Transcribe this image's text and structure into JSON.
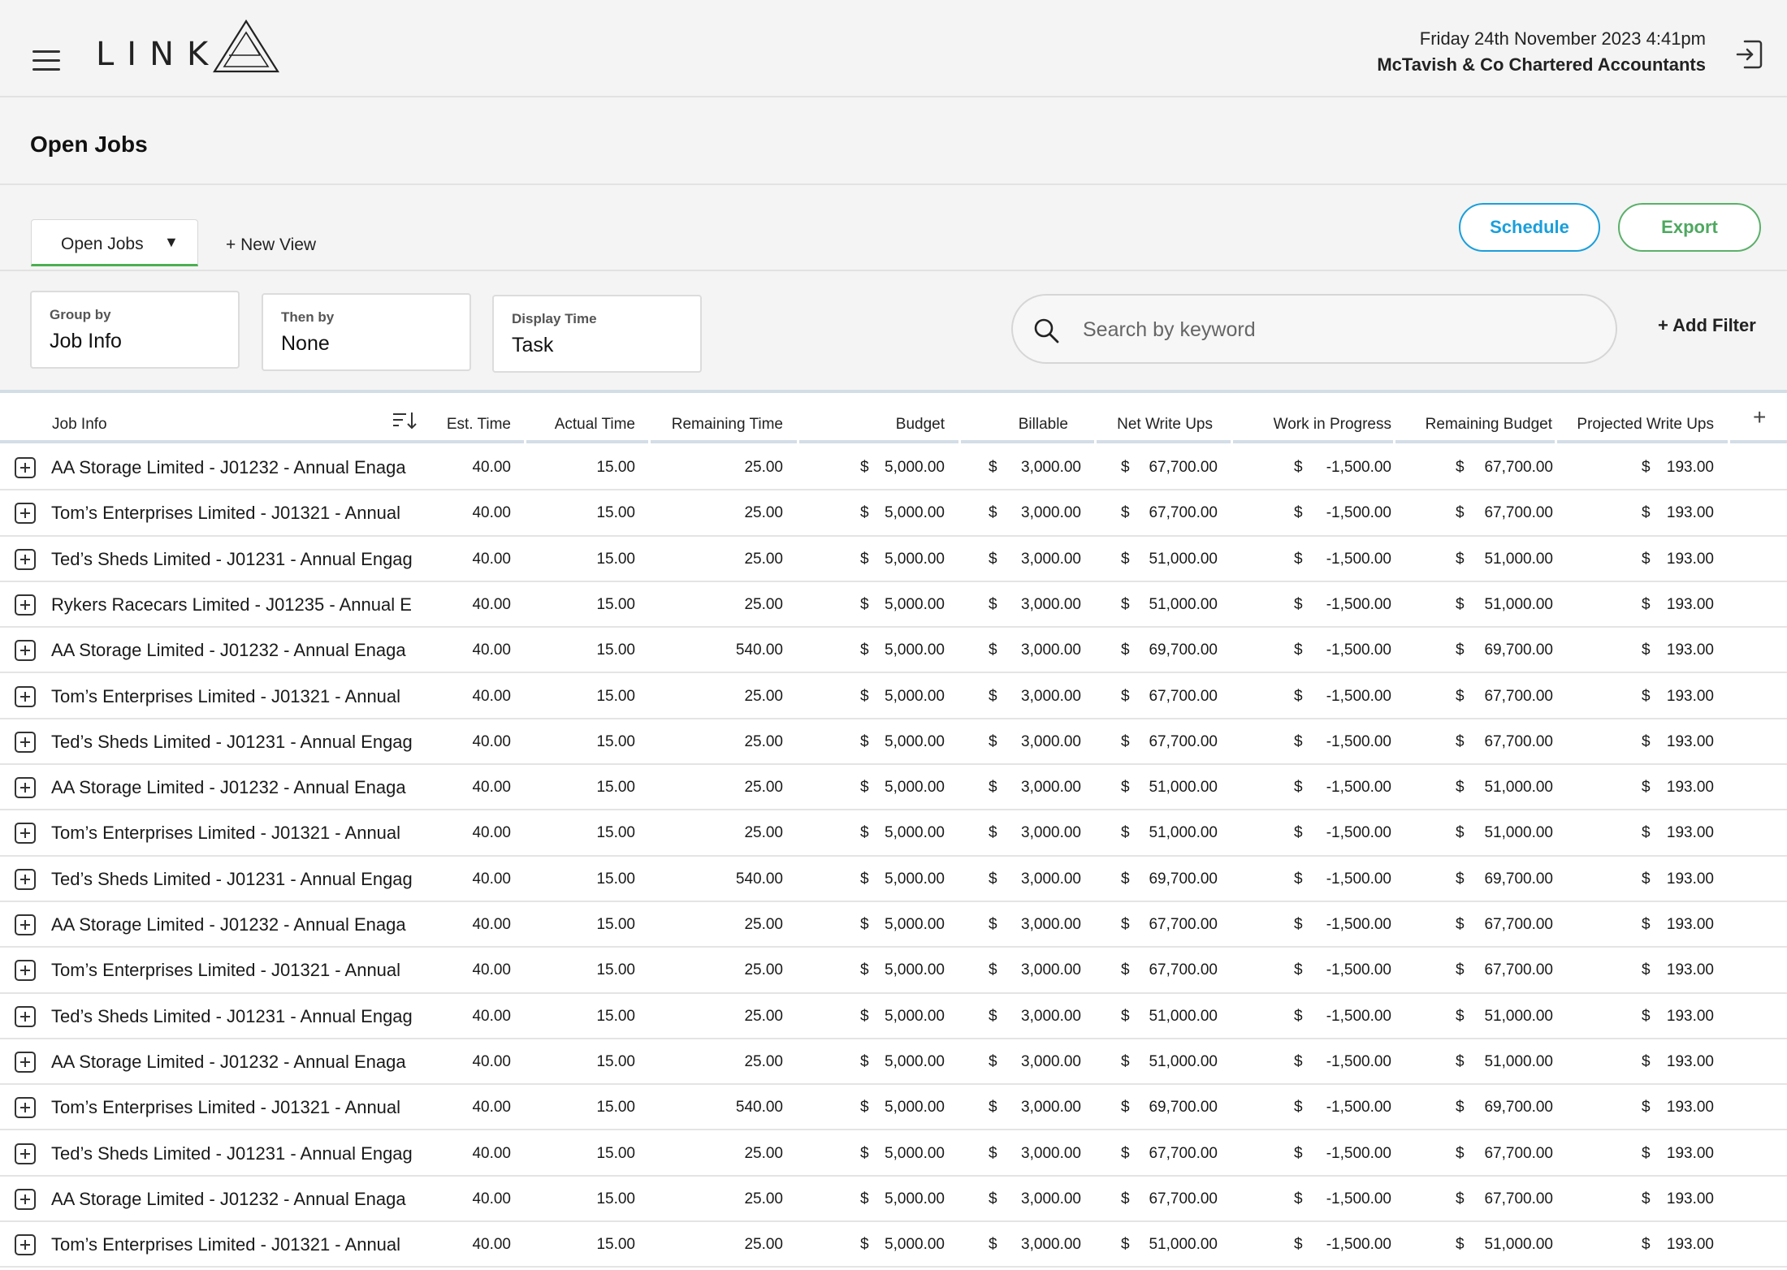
{
  "app": {
    "logo_text": "LINK",
    "date_time": "Friday 24th November 2023  4:41pm",
    "firm_name": "McTavish & Co Chartered Accountants"
  },
  "page": {
    "title": "Open Jobs"
  },
  "views": {
    "active_view": "Open Jobs",
    "new_view_label": "+ New View",
    "schedule_label": "Schedule",
    "export_label": "Export"
  },
  "filters": {
    "group_by": {
      "label": "Group by",
      "value": "Job Info"
    },
    "then_by": {
      "label": "Then by",
      "value": "None"
    },
    "display_time": {
      "label": "Display Time",
      "value": "Task"
    },
    "search_placeholder": "Search by keyword",
    "add_filter_label": "+ Add Filter"
  },
  "colors": {
    "schedule": "#1a9fdb",
    "export": "#4ea860",
    "active_tab_underline": "#4caf50"
  },
  "icons": [
    "hamburger-menu-icon",
    "logo-triangle-icon",
    "logout-icon",
    "search-icon",
    "sort-icon",
    "add-column-icon",
    "expand-row-icon"
  ],
  "table": {
    "columns": [
      "Job Info",
      "Est. Time",
      "Actual Time",
      "Remaining Time",
      "Budget",
      "Billable",
      "Net Write Ups",
      "Work in Progress",
      "Remaining Budget",
      "Projected Write Ups"
    ],
    "currency": "$",
    "rows": [
      {
        "job": "AA Storage Limited - J01232 - Annual Enaga",
        "est": "40.00",
        "actual": "15.00",
        "remaining": "25.00",
        "budget": "5,000.00",
        "billable": "3,000.00",
        "net": "67,700.00",
        "wip": "-1,500.00",
        "rem_budget": "67,700.00",
        "proj": "193.00"
      },
      {
        "job": "Tom’s Enterprises Limited - J01321 - Annual",
        "est": "40.00",
        "actual": "15.00",
        "remaining": "25.00",
        "budget": "5,000.00",
        "billable": "3,000.00",
        "net": "67,700.00",
        "wip": "-1,500.00",
        "rem_budget": "67,700.00",
        "proj": "193.00"
      },
      {
        "job": "Ted’s Sheds Limited - J01231 - Annual Engag",
        "est": "40.00",
        "actual": "15.00",
        "remaining": "25.00",
        "budget": "5,000.00",
        "billable": "3,000.00",
        "net": "51,000.00",
        "wip": "-1,500.00",
        "rem_budget": "51,000.00",
        "proj": "193.00"
      },
      {
        "job": "Rykers Racecars Limited - J01235 - Annual E",
        "est": "40.00",
        "actual": "15.00",
        "remaining": "25.00",
        "budget": "5,000.00",
        "billable": "3,000.00",
        "net": "51,000.00",
        "wip": "-1,500.00",
        "rem_budget": "51,000.00",
        "proj": "193.00"
      },
      {
        "job": "AA Storage Limited - J01232 - Annual Enaga",
        "est": "40.00",
        "actual": "15.00",
        "remaining": "540.00",
        "budget": "5,000.00",
        "billable": "3,000.00",
        "net": "69,700.00",
        "wip": "-1,500.00",
        "rem_budget": "69,700.00",
        "proj": "193.00"
      },
      {
        "job": "Tom’s Enterprises Limited - J01321 - Annual",
        "est": "40.00",
        "actual": "15.00",
        "remaining": "25.00",
        "budget": "5,000.00",
        "billable": "3,000.00",
        "net": "67,700.00",
        "wip": "-1,500.00",
        "rem_budget": "67,700.00",
        "proj": "193.00"
      },
      {
        "job": "Ted’s Sheds Limited - J01231 - Annual Engag",
        "est": "40.00",
        "actual": "15.00",
        "remaining": "25.00",
        "budget": "5,000.00",
        "billable": "3,000.00",
        "net": "67,700.00",
        "wip": "-1,500.00",
        "rem_budget": "67,700.00",
        "proj": "193.00"
      },
      {
        "job": "AA Storage Limited - J01232 - Annual Enaga",
        "est": "40.00",
        "actual": "15.00",
        "remaining": "25.00",
        "budget": "5,000.00",
        "billable": "3,000.00",
        "net": "51,000.00",
        "wip": "-1,500.00",
        "rem_budget": "51,000.00",
        "proj": "193.00"
      },
      {
        "job": "Tom’s Enterprises Limited - J01321 - Annual",
        "est": "40.00",
        "actual": "15.00",
        "remaining": "25.00",
        "budget": "5,000.00",
        "billable": "3,000.00",
        "net": "51,000.00",
        "wip": "-1,500.00",
        "rem_budget": "51,000.00",
        "proj": "193.00"
      },
      {
        "job": "Ted’s Sheds Limited - J01231 - Annual Engag",
        "est": "40.00",
        "actual": "15.00",
        "remaining": "540.00",
        "budget": "5,000.00",
        "billable": "3,000.00",
        "net": "69,700.00",
        "wip": "-1,500.00",
        "rem_budget": "69,700.00",
        "proj": "193.00"
      },
      {
        "job": "AA Storage Limited - J01232 - Annual Enaga",
        "est": "40.00",
        "actual": "15.00",
        "remaining": "25.00",
        "budget": "5,000.00",
        "billable": "3,000.00",
        "net": "67,700.00",
        "wip": "-1,500.00",
        "rem_budget": "67,700.00",
        "proj": "193.00"
      },
      {
        "job": "Tom’s Enterprises Limited - J01321 - Annual",
        "est": "40.00",
        "actual": "15.00",
        "remaining": "25.00",
        "budget": "5,000.00",
        "billable": "3,000.00",
        "net": "67,700.00",
        "wip": "-1,500.00",
        "rem_budget": "67,700.00",
        "proj": "193.00"
      },
      {
        "job": "Ted’s Sheds Limited - J01231 - Annual Engag",
        "est": "40.00",
        "actual": "15.00",
        "remaining": "25.00",
        "budget": "5,000.00",
        "billable": "3,000.00",
        "net": "51,000.00",
        "wip": "-1,500.00",
        "rem_budget": "51,000.00",
        "proj": "193.00"
      },
      {
        "job": "AA Storage Limited - J01232 - Annual Enaga",
        "est": "40.00",
        "actual": "15.00",
        "remaining": "25.00",
        "budget": "5,000.00",
        "billable": "3,000.00",
        "net": "51,000.00",
        "wip": "-1,500.00",
        "rem_budget": "51,000.00",
        "proj": "193.00"
      },
      {
        "job": "Tom’s Enterprises Limited - J01321 - Annual",
        "est": "40.00",
        "actual": "15.00",
        "remaining": "540.00",
        "budget": "5,000.00",
        "billable": "3,000.00",
        "net": "69,700.00",
        "wip": "-1,500.00",
        "rem_budget": "69,700.00",
        "proj": "193.00"
      },
      {
        "job": "Ted’s Sheds Limited - J01231 - Annual Engag",
        "est": "40.00",
        "actual": "15.00",
        "remaining": "25.00",
        "budget": "5,000.00",
        "billable": "3,000.00",
        "net": "67,700.00",
        "wip": "-1,500.00",
        "rem_budget": "67,700.00",
        "proj": "193.00"
      },
      {
        "job": "AA Storage Limited - J01232 - Annual Enaga",
        "est": "40.00",
        "actual": "15.00",
        "remaining": "25.00",
        "budget": "5,000.00",
        "billable": "3,000.00",
        "net": "67,700.00",
        "wip": "-1,500.00",
        "rem_budget": "67,700.00",
        "proj": "193.00"
      },
      {
        "job": "Tom’s Enterprises Limited - J01321 - Annual",
        "est": "40.00",
        "actual": "15.00",
        "remaining": "25.00",
        "budget": "5,000.00",
        "billable": "3,000.00",
        "net": "51,000.00",
        "wip": "-1,500.00",
        "rem_budget": "51,000.00",
        "proj": "193.00"
      }
    ]
  }
}
